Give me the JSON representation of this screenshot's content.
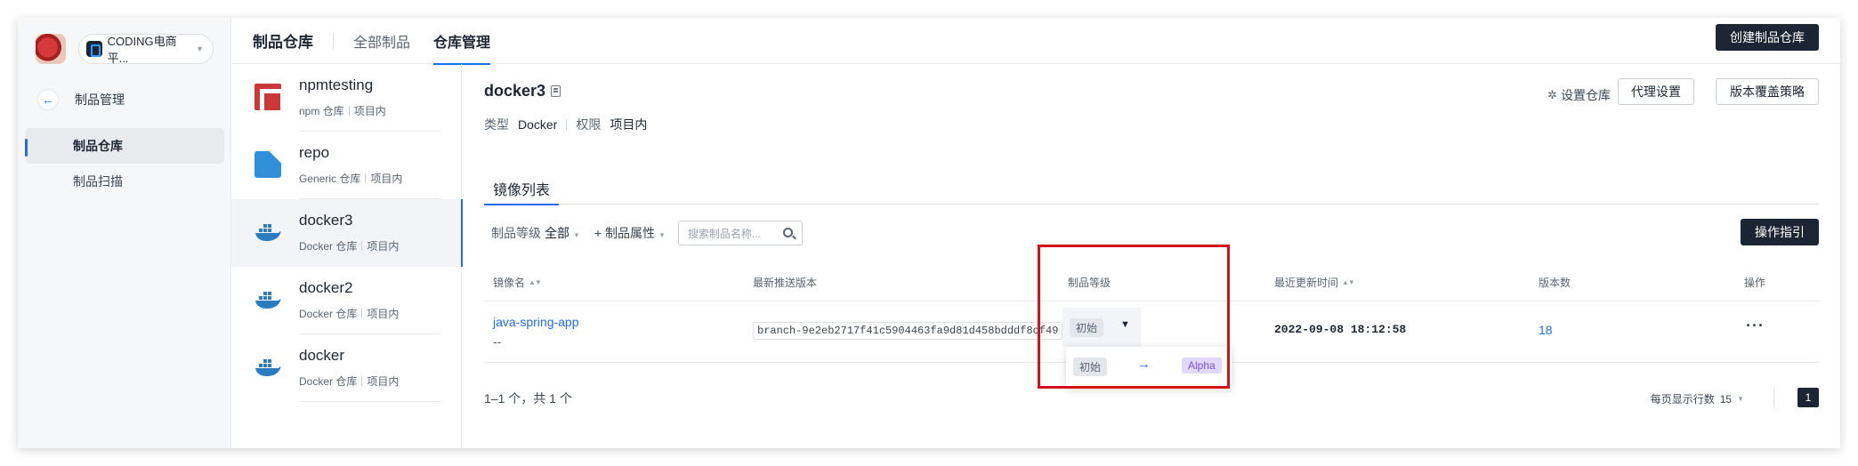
{
  "sidebar": {
    "project_name": "CODING电商平...",
    "back_label": "制品管理",
    "items": [
      {
        "label": "制品仓库",
        "active": true
      },
      {
        "label": "制品扫描",
        "active": false
      }
    ]
  },
  "header": {
    "title": "制品仓库",
    "tabs": [
      {
        "label": "全部制品",
        "active": false
      },
      {
        "label": "仓库管理",
        "active": true
      }
    ],
    "create_button": "创建制品仓库"
  },
  "repos": [
    {
      "name": "npmtesting",
      "type": "npm 仓库",
      "scope": "项目内",
      "icon": "npm-icon"
    },
    {
      "name": "repo",
      "type": "Generic 仓库",
      "scope": "项目内",
      "icon": "generic-icon"
    },
    {
      "name": "docker3",
      "type": "Docker 仓库",
      "scope": "项目内",
      "icon": "docker-icon",
      "active": true
    },
    {
      "name": "docker2",
      "type": "Docker 仓库",
      "scope": "项目内",
      "icon": "docker-icon"
    },
    {
      "name": "docker",
      "type": "Docker 仓库",
      "scope": "项目内",
      "icon": "docker-icon"
    }
  ],
  "detail": {
    "title": "docker3",
    "type_label": "类型",
    "type_value": "Docker",
    "perm_label": "权限",
    "perm_value": "项目内",
    "settings_label": "设置仓库",
    "proxy_button": "代理设置",
    "policy_button": "版本覆盖策略",
    "tab_label": "镜像列表",
    "filter_level_label": "制品等级",
    "filter_level_value": "全部",
    "filter_attr_label": "+ 制品属性",
    "search_placeholder": "搜索制品名称...",
    "guide_button": "操作指引"
  },
  "table": {
    "columns": [
      "镜像名",
      "最新推送版本",
      "制品等级",
      "最近更新时间",
      "版本数",
      "操作"
    ],
    "rows": [
      {
        "name": "java-spring-app",
        "description": "--",
        "latest_version": "branch-9e2eb2717f41c5904463fa9d81d458bdddf8cf49",
        "level": "初始",
        "updated": "2022-09-08 18:12:58",
        "versions": "18"
      }
    ]
  },
  "level_dropdown": {
    "from": "初始",
    "to": "Alpha"
  },
  "pagination": {
    "summary": "1–1 个，共 1 个",
    "page_size_label": "每页显示行数",
    "page_size_value": "15",
    "current_page": "1"
  },
  "colors": {
    "accent": "#1f6cf0",
    "dark": "#1b2533",
    "highlight": "#d5101a",
    "alpha_badge": "#7a4ee6"
  }
}
